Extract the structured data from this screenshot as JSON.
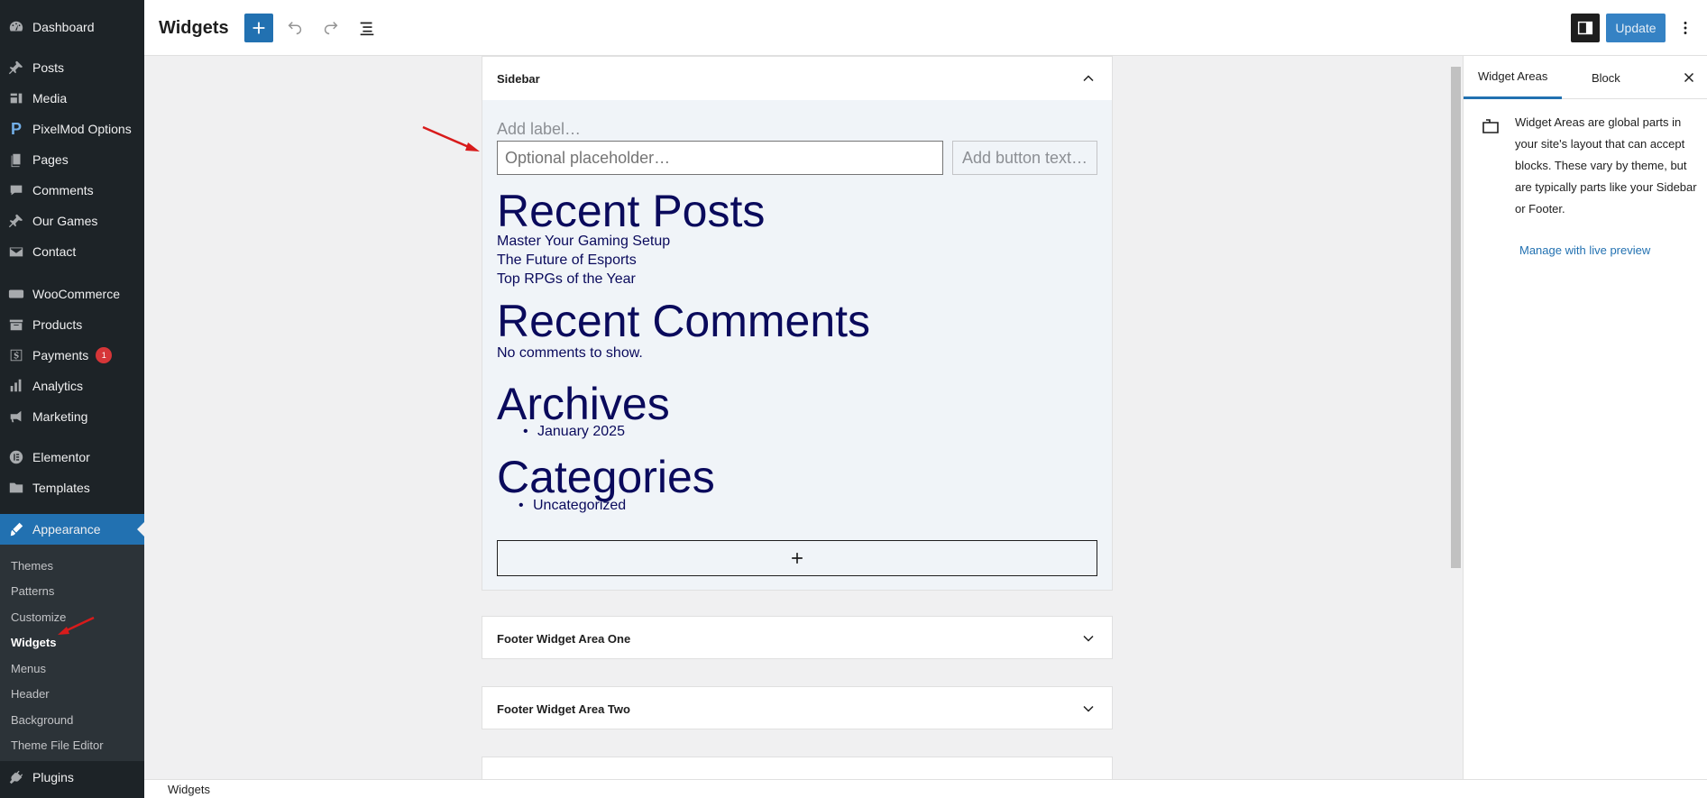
{
  "admin_menu": {
    "items": [
      {
        "label": "Dashboard",
        "icon": "dashboard-icon"
      },
      {
        "label": "Posts",
        "icon": "pushpin-icon"
      },
      {
        "label": "Media",
        "icon": "media-icon"
      },
      {
        "label": "PixelMod Options",
        "icon": "pixelmod-icon"
      },
      {
        "label": "Pages",
        "icon": "pages-icon"
      },
      {
        "label": "Comments",
        "icon": "comments-icon"
      },
      {
        "label": "Our Games",
        "icon": "pushpin-icon"
      },
      {
        "label": "Contact",
        "icon": "envelope-icon"
      },
      {
        "label": "WooCommerce",
        "icon": "woocommerce-icon"
      },
      {
        "label": "Products",
        "icon": "archive-icon"
      },
      {
        "label": "Payments",
        "icon": "dollar-icon",
        "badge": "1"
      },
      {
        "label": "Analytics",
        "icon": "bar-chart-icon"
      },
      {
        "label": "Marketing",
        "icon": "megaphone-icon"
      },
      {
        "label": "Elementor",
        "icon": "elementor-icon"
      },
      {
        "label": "Templates",
        "icon": "folder-icon"
      },
      {
        "label": "Appearance",
        "icon": "brush-icon"
      },
      {
        "label": "Plugins",
        "icon": "plug-icon"
      }
    ],
    "submenu": [
      "Themes",
      "Patterns",
      "Customize",
      "Widgets",
      "Menus",
      "Header",
      "Background",
      "Theme File Editor"
    ]
  },
  "toolbar": {
    "title": "Widgets",
    "update_label": "Update"
  },
  "sidebar_area": {
    "title": "Sidebar",
    "search_label_placeholder": "Add label…",
    "search_input_placeholder": "Optional placeholder…",
    "search_button_placeholder": "Add button text…",
    "recent_posts_heading": "Recent Posts",
    "recent_posts": [
      "Master Your Gaming Setup",
      "The Future of Esports",
      "Top RPGs of the Year"
    ],
    "recent_comments_heading": "Recent Comments",
    "recent_comments_empty": "No comments to show.",
    "archives_heading": "Archives",
    "archives": [
      "January 2025"
    ],
    "categories_heading": "Categories",
    "categories": [
      "Uncategorized"
    ]
  },
  "footer_areas": [
    "Footer Widget Area One",
    "Footer Widget Area Two"
  ],
  "settings_panel": {
    "tab_widget_areas": "Widget Areas",
    "tab_block": "Block",
    "description": "Widget Areas are global parts in your site's layout that can accept blocks. These vary by theme, but are typically parts like your Sidebar or Footer.",
    "manage_link": "Manage with live preview"
  },
  "breadcrumb": "Widgets",
  "colors": {
    "accent": "#2271b1",
    "admin_bg": "#1d2327",
    "badge": "#d63638",
    "widget_text": "#0a0a5c",
    "annotation": "#d81b1b"
  }
}
